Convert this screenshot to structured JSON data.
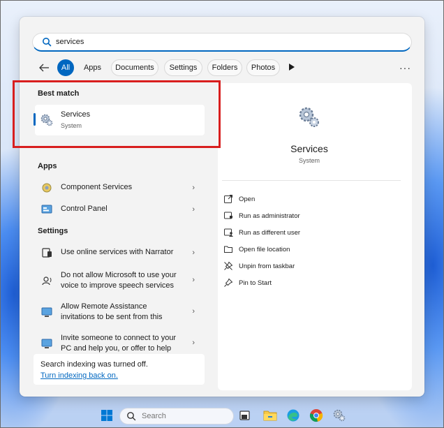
{
  "search": {
    "query": "services"
  },
  "filters": {
    "chips": [
      "All",
      "Apps",
      "Documents",
      "Settings",
      "Folders",
      "Photos"
    ],
    "more_label": "···"
  },
  "results": {
    "best_match_title": "Best match",
    "best": {
      "name": "Services",
      "type": "System"
    },
    "apps_title": "Apps",
    "apps": [
      {
        "label": "Component Services"
      },
      {
        "label": "Control Panel"
      }
    ],
    "settings_title": "Settings",
    "settings": [
      {
        "label": "Use online services with Narrator"
      },
      {
        "line1": "Do not allow Microsoft to use your",
        "line2": "voice to improve speech services"
      },
      {
        "line1": "Allow Remote Assistance",
        "line2": "invitations to be sent from this"
      },
      {
        "line1": "Invite someone to connect to your",
        "line2": "PC and help you, or offer to help"
      }
    ],
    "notice": {
      "text": "Search indexing was turned off.",
      "link": "Turn indexing back on."
    },
    "chevron": "›"
  },
  "preview": {
    "title": "Services",
    "subtitle": "System",
    "actions": [
      {
        "label": "Open",
        "icon": "open-icon"
      },
      {
        "label": "Run as administrator",
        "icon": "shield-icon"
      },
      {
        "label": "Run as different user",
        "icon": "user-icon"
      },
      {
        "label": "Open file location",
        "icon": "folder-icon"
      },
      {
        "label": "Unpin from taskbar",
        "icon": "unpin-icon"
      },
      {
        "label": "Pin to Start",
        "icon": "pin-icon"
      }
    ]
  },
  "taskbar": {
    "search_placeholder": "Search",
    "items": [
      "windows-start-icon",
      "task-view-icon",
      "file-explorer-icon",
      "edge-icon",
      "chrome-icon",
      "services-icon"
    ]
  },
  "colors": {
    "accent": "#0067c0",
    "highlight": "#d81e1e"
  }
}
